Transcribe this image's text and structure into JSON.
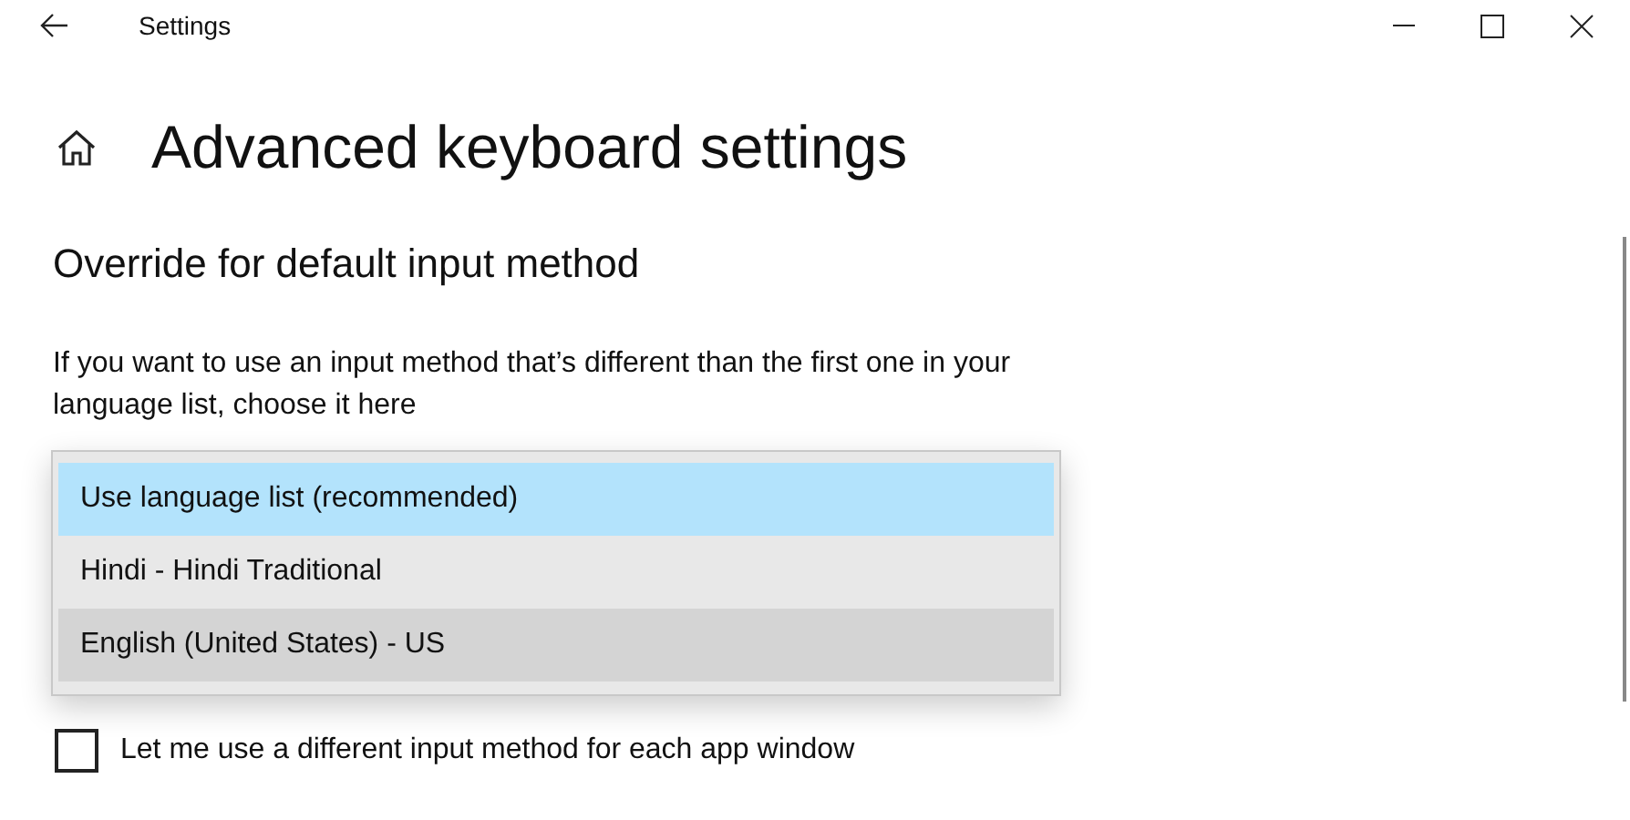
{
  "window": {
    "title": "Settings"
  },
  "page_title": "Advanced keyboard settings",
  "section": {
    "heading": "Override for default input method",
    "description": "If you want to use an input method that’s different than the first one in your language list, choose it here"
  },
  "dropdown": {
    "expanded": true,
    "options": [
      {
        "label": "Use language list (recommended)",
        "selected": true,
        "hovered": false
      },
      {
        "label": "Hindi - Hindi Traditional",
        "selected": false,
        "hovered": false
      },
      {
        "label": "English (United States) - US",
        "selected": false,
        "hovered": true
      }
    ]
  },
  "checkbox": {
    "label": "Let me use a different input method for each app window",
    "checked": false
  }
}
